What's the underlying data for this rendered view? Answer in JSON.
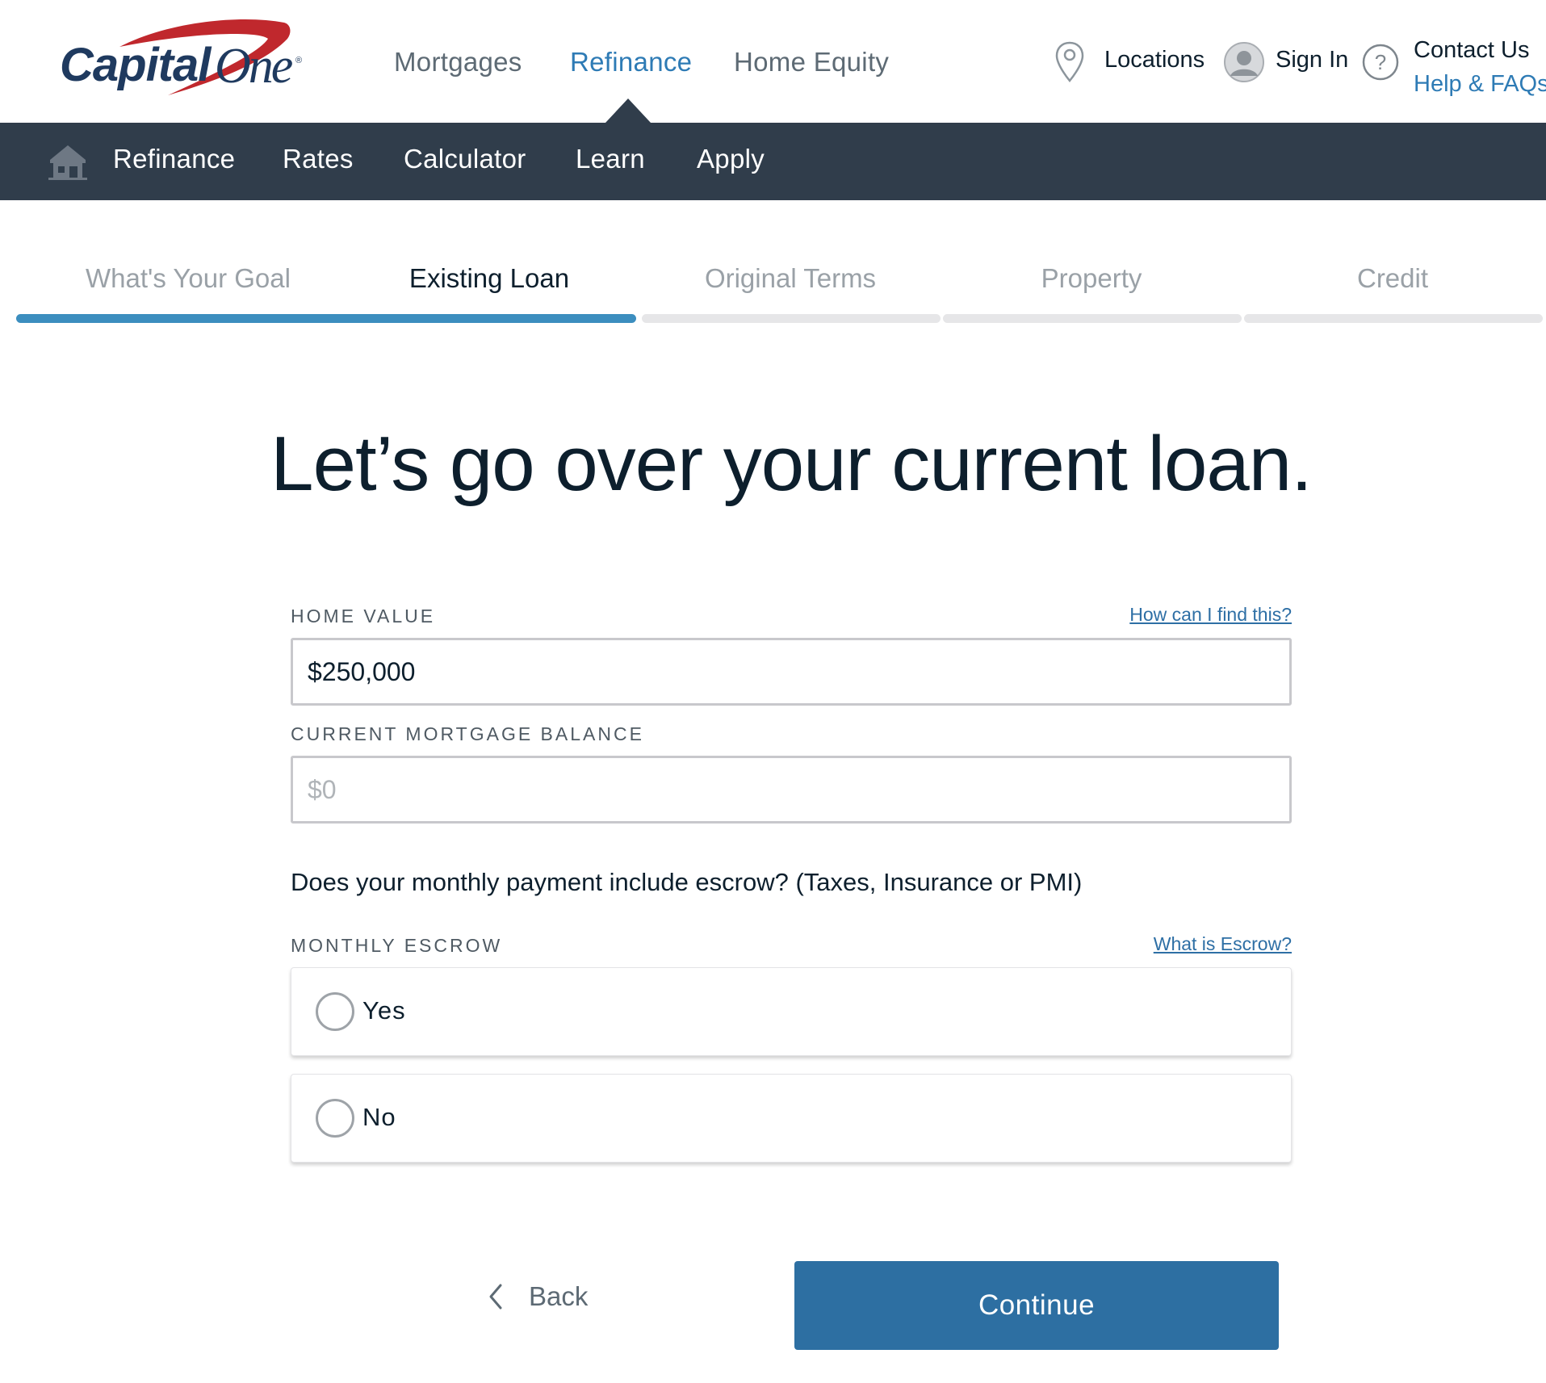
{
  "brand": {
    "logo_text": "CapitalOne",
    "logo_mark": "®"
  },
  "top_nav": {
    "items": [
      {
        "label": "Mortgages",
        "active": false
      },
      {
        "label": "Refinance",
        "active": true
      },
      {
        "label": "Home Equity",
        "active": false
      }
    ]
  },
  "utility_nav": {
    "locations": "Locations",
    "sign_in": "Sign In",
    "contact_us": "Contact Us",
    "help_faqs": "Help & FAQs"
  },
  "sub_nav": {
    "home_icon": "house-icon",
    "items": [
      "Refinance",
      "Rates",
      "Calculator",
      "Learn",
      "Apply"
    ]
  },
  "progress": {
    "steps": [
      {
        "label": "What's Your Goal",
        "state": "done"
      },
      {
        "label": "Existing Loan",
        "state": "current"
      },
      {
        "label": "Original Terms",
        "state": "todo"
      },
      {
        "label": "Property",
        "state": "todo"
      },
      {
        "label": "Credit",
        "state": "todo"
      }
    ]
  },
  "heading": "Let’s go over your current loan.",
  "form": {
    "home_value": {
      "label": "HOME VALUE",
      "help_link": "How can I find this?",
      "value": "$250,000"
    },
    "mortgage_balance": {
      "label": "CURRENT MORTGAGE BALANCE",
      "placeholder": "$0",
      "value": ""
    },
    "escrow_question": "Does your monthly payment include escrow? (Taxes, Insurance or PMI)",
    "monthly_escrow": {
      "label": "MONTHLY ESCROW",
      "help_link": "What is Escrow?",
      "options": [
        "Yes",
        "No"
      ]
    }
  },
  "actions": {
    "back": "Back",
    "continue": "Continue"
  },
  "colors": {
    "accent": "#2e7bb5",
    "subnav_bg": "#303d4b",
    "continue_bg": "#2d6fa2",
    "progress_fill": "#3c8ebf",
    "brand_red": "#c0282d",
    "brand_navy": "#1f3a5f"
  }
}
